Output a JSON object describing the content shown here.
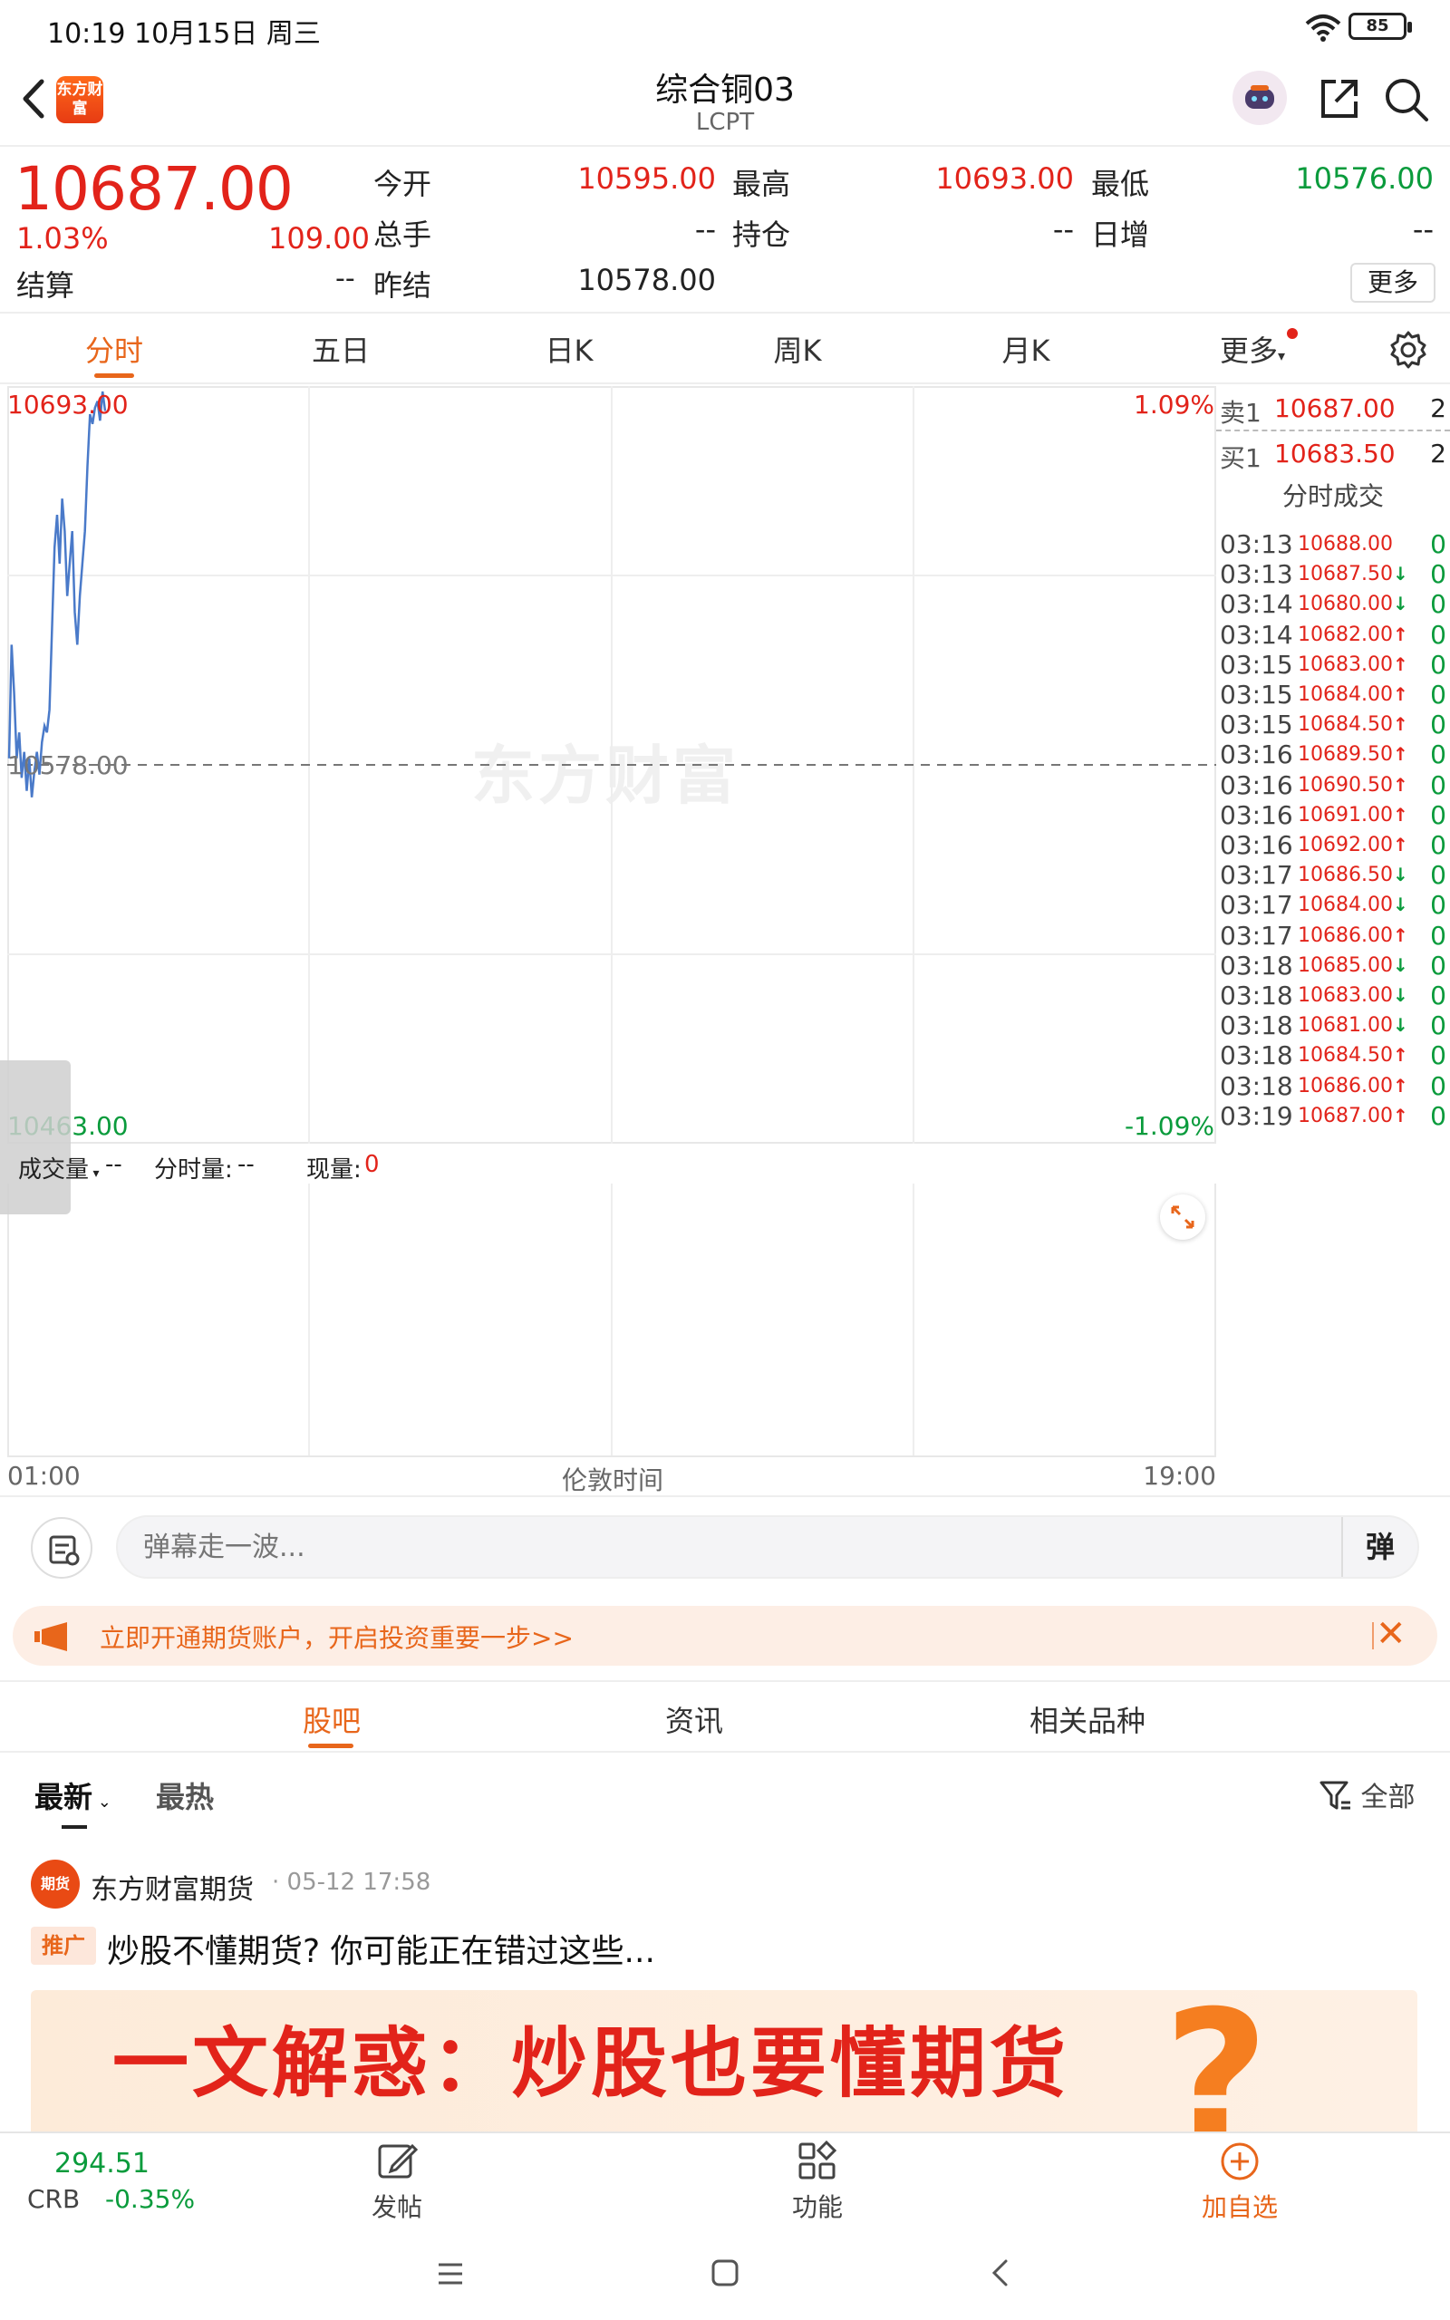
{
  "status": {
    "time": "10:19  10月15日 周三",
    "battery": "85"
  },
  "header": {
    "title": "综合铜03",
    "code": "LCPT",
    "logo_text": "东方财富"
  },
  "quote": {
    "price": "10687.00",
    "change_pct": "1.03%",
    "change_abs": "109.00",
    "settle_label": "结算",
    "settle_value": "--",
    "fields": [
      {
        "label": "今开",
        "value": "10595.00",
        "color": "#e2231a"
      },
      {
        "label": "最高",
        "value": "10693.00",
        "color": "#e2231a"
      },
      {
        "label": "最低",
        "value": "10576.00",
        "color": "#0a9b3c"
      },
      {
        "label": "总手",
        "value": "--",
        "color": "#222222"
      },
      {
        "label": "持仓",
        "value": "--",
        "color": "#222222"
      },
      {
        "label": "日增",
        "value": "--",
        "color": "#222222"
      },
      {
        "label": "昨结",
        "value": "10578.00",
        "color": "#222222"
      }
    ],
    "more_label": "更多"
  },
  "chart_tabs": [
    "分时",
    "五日",
    "日K",
    "周K",
    "月K",
    "更多"
  ],
  "chart": {
    "watermark": "东方财富",
    "label_high": "10693.00",
    "label_mid": "10578.00",
    "label_low": "10463.00",
    "pct_high": "1.09%",
    "pct_low": "-1.09%",
    "time_start": "01:00",
    "time_mid": "伦敦时间",
    "time_end": "19:00"
  },
  "chart_data": {
    "type": "line",
    "x_label": "伦敦时间",
    "x_range": [
      "01:00",
      "19:00"
    ],
    "ylim": [
      10463.0,
      10693.0
    ],
    "reference_line": 10578.0,
    "series": [
      {
        "values": [
          10580,
          10615,
          10600,
          10580,
          10588,
          10574,
          10582,
          10570,
          10580,
          10568,
          10576,
          10582,
          10575,
          10585,
          10590,
          10588,
          10595,
          10620,
          10645,
          10655,
          10640,
          10660,
          10650,
          10630,
          10640,
          10650,
          10625,
          10615,
          10630,
          10640,
          10650,
          10670,
          10686,
          10683,
          10688,
          10690,
          10684,
          10693,
          10687
        ]
      }
    ]
  },
  "volume": {
    "label": "成交量",
    "value": "--",
    "fs_label": "分时量:",
    "fs_value": "--",
    "now_label": "现量:",
    "now_value": "0"
  },
  "order_book": {
    "sell_label": "卖1",
    "sell_price": "10687.00",
    "sell_qty": "2",
    "buy_label": "买1",
    "buy_price": "10683.50",
    "buy_qty": "2",
    "title": "分时成交",
    "ticks": [
      {
        "time": "03:13",
        "price": "10688.00",
        "dir": "",
        "qty": "0"
      },
      {
        "time": "03:13",
        "price": "10687.50",
        "dir": "↓",
        "qty": "0"
      },
      {
        "time": "03:14",
        "price": "10680.00",
        "dir": "↓",
        "qty": "0"
      },
      {
        "time": "03:14",
        "price": "10682.00",
        "dir": "↑",
        "qty": "0"
      },
      {
        "time": "03:15",
        "price": "10683.00",
        "dir": "↑",
        "qty": "0"
      },
      {
        "time": "03:15",
        "price": "10684.00",
        "dir": "↑",
        "qty": "0"
      },
      {
        "time": "03:15",
        "price": "10684.50",
        "dir": "↑",
        "qty": "0"
      },
      {
        "time": "03:16",
        "price": "10689.50",
        "dir": "↑",
        "qty": "0"
      },
      {
        "time": "03:16",
        "price": "10690.50",
        "dir": "↑",
        "qty": "0"
      },
      {
        "time": "03:16",
        "price": "10691.00",
        "dir": "↑",
        "qty": "0"
      },
      {
        "time": "03:16",
        "price": "10692.00",
        "dir": "↑",
        "qty": "0"
      },
      {
        "time": "03:17",
        "price": "10686.50",
        "dir": "↓",
        "qty": "0"
      },
      {
        "time": "03:17",
        "price": "10684.00",
        "dir": "↓",
        "qty": "0"
      },
      {
        "time": "03:17",
        "price": "10686.00",
        "dir": "↑",
        "qty": "0"
      },
      {
        "time": "03:18",
        "price": "10685.00",
        "dir": "↓",
        "qty": "0"
      },
      {
        "time": "03:18",
        "price": "10683.00",
        "dir": "↓",
        "qty": "0"
      },
      {
        "time": "03:18",
        "price": "10681.00",
        "dir": "↓",
        "qty": "0"
      },
      {
        "time": "03:18",
        "price": "10684.50",
        "dir": "↑",
        "qty": "0"
      },
      {
        "time": "03:18",
        "price": "10686.00",
        "dir": "↑",
        "qty": "0"
      },
      {
        "time": "03:19",
        "price": "10687.00",
        "dir": "↑",
        "qty": "0"
      }
    ]
  },
  "danmu": {
    "placeholder": "弹幕走一波...",
    "send_label": "弹"
  },
  "promo": {
    "text": "立即开通期货账户，开启投资重要一步>>"
  },
  "section_tabs": [
    "股吧",
    "资讯",
    "相关品种"
  ],
  "feed": {
    "sort_latest": "最新",
    "sort_hot": "最热",
    "filter_label": "全部",
    "post": {
      "avatar_text": "期货",
      "author": "东方财富期货",
      "time": "· 05-12 17:58",
      "tag": "推广",
      "title": "炒股不懂期货? 你可能正在错过这些...",
      "image_text": "一文解惑：炒股也要懂期货",
      "image_q": "?"
    }
  },
  "bottom_bar": {
    "index_value": "294.51",
    "index_name": "CRB",
    "index_change": "-0.35%",
    "post_label": "发帖",
    "function_label": "功能",
    "add_label": "加自选"
  },
  "colors": {
    "up": "#e2231a",
    "down": "#0a9b3c",
    "accent": "#e8661b"
  }
}
